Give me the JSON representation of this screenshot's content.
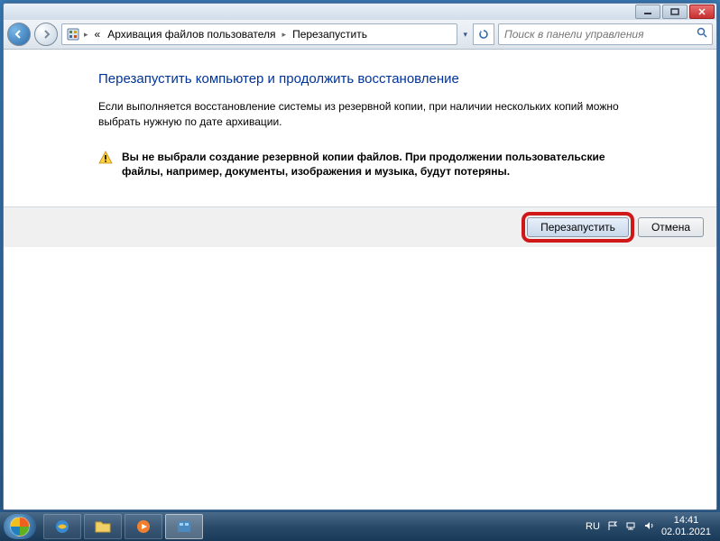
{
  "breadcrumb": {
    "prefix": "«",
    "item1": "Архивация файлов пользователя",
    "item2": "Перезапустить"
  },
  "search": {
    "placeholder": "Поиск в панели управления"
  },
  "main": {
    "heading": "Перезапустить компьютер и продолжить восстановление",
    "body": "Если выполняется восстановление системы из резервной копии, при наличии нескольких копий можно выбрать нужную по дате архивации.",
    "warning": "Вы не выбрали создание резервной копии файлов. При продолжении пользовательские файлы, например, документы, изображения и музыка, будут потеряны."
  },
  "buttons": {
    "restart": "Перезапустить",
    "cancel": "Отмена"
  },
  "tray": {
    "lang": "RU",
    "time": "14:41",
    "date": "02.01.2021"
  }
}
